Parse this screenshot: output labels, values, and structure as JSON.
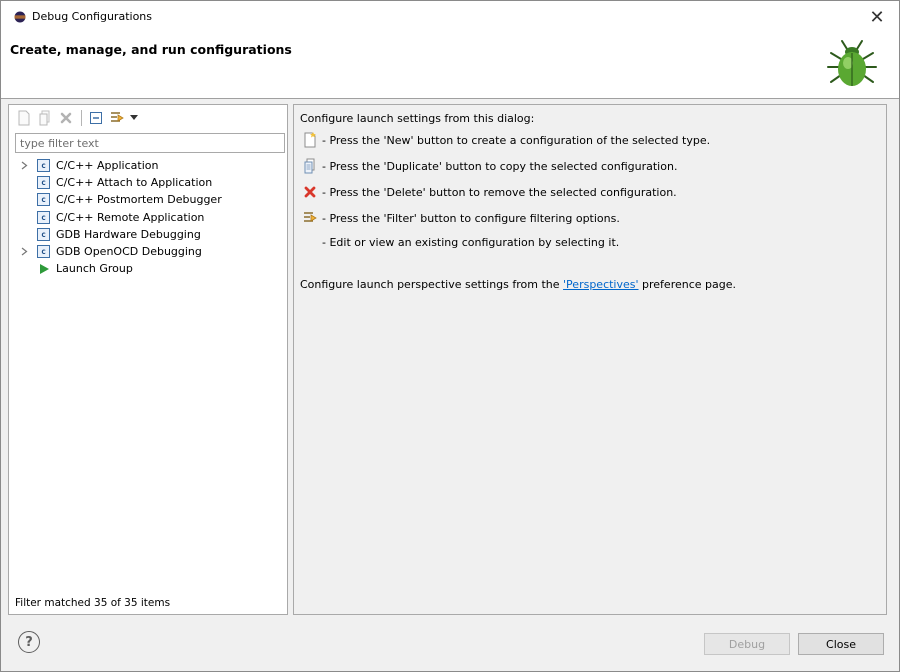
{
  "window": {
    "title": "Debug Configurations",
    "close_glyph": "✕"
  },
  "banner": {
    "title": "Create, manage, and run configurations",
    "icon": "bug-icon"
  },
  "left": {
    "filter_placeholder": "type filter text",
    "tree": [
      {
        "label": "C/C++ Application",
        "icon": "c-config-icon",
        "expandable": true
      },
      {
        "label": "C/C++ Attach to Application",
        "icon": "c-config-icon",
        "expandable": false
      },
      {
        "label": "C/C++ Postmortem Debugger",
        "icon": "c-config-icon",
        "expandable": false
      },
      {
        "label": "C/C++ Remote Application",
        "icon": "c-config-icon",
        "expandable": false
      },
      {
        "label": "GDB Hardware Debugging",
        "icon": "c-config-icon",
        "expandable": false
      },
      {
        "label": "GDB OpenOCD Debugging",
        "icon": "c-config-icon",
        "expandable": true
      },
      {
        "label": "Launch Group",
        "icon": "launch-group-icon",
        "expandable": false
      }
    ],
    "status": "Filter matched 35 of 35 items"
  },
  "right": {
    "intro": "Configure launch settings from this dialog:",
    "items": [
      {
        "icon": "new-config-icon",
        "text": "- Press the 'New' button to create a configuration of the selected type."
      },
      {
        "icon": "duplicate-icon",
        "text": "- Press the 'Duplicate' button to copy the selected configuration."
      },
      {
        "icon": "delete-icon",
        "text": "- Press the 'Delete' button to remove the selected configuration."
      },
      {
        "icon": "filter-icon",
        "text": "- Press the 'Filter' button to configure filtering options."
      },
      {
        "icon": "",
        "text": "- Edit or view an existing configuration by selecting it."
      }
    ],
    "perspective_prefix": "Configure launch perspective settings from the ",
    "perspective_link": "'Perspectives'",
    "perspective_suffix": " preference page."
  },
  "footer": {
    "help_glyph": "?",
    "debug_label": "Debug",
    "close_label": "Close"
  },
  "colors": {
    "accent": "#0066cc",
    "delete_red": "#d9372b",
    "launch_green": "#2e9a3a"
  }
}
